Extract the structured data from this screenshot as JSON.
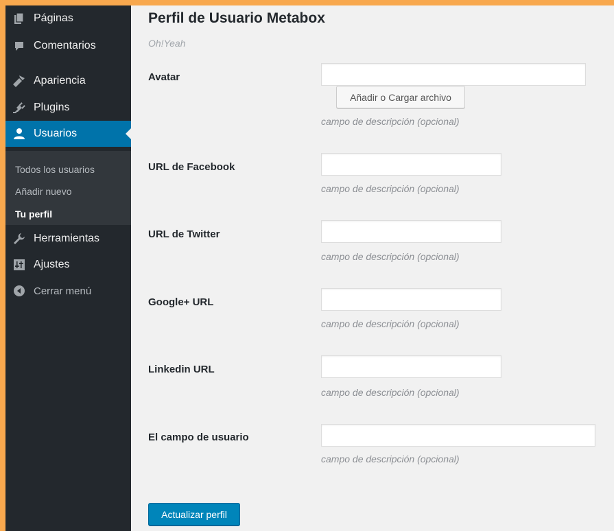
{
  "sidebar": {
    "items": [
      {
        "label": "Páginas",
        "icon": "pages-icon"
      },
      {
        "label": "Comentarios",
        "icon": "comments-icon"
      },
      {
        "label": "Apariencia",
        "icon": "appearance-icon"
      },
      {
        "label": "Plugins",
        "icon": "plugins-icon"
      },
      {
        "label": "Usuarios",
        "icon": "users-icon",
        "active": true
      },
      {
        "label": "Herramientas",
        "icon": "tools-icon"
      },
      {
        "label": "Ajustes",
        "icon": "settings-icon"
      },
      {
        "label": "Cerrar menú",
        "icon": "collapse-menu-icon"
      }
    ],
    "submenu": [
      {
        "label": "Todos los usuarios"
      },
      {
        "label": "Añadir nuevo"
      },
      {
        "label": "Tu perfil",
        "current": true
      }
    ]
  },
  "main": {
    "title": "Perfil de Usuario Metabox",
    "subtitle": "Oh!Yeah",
    "upload_button": "Añadir o Cargar archivo",
    "fields": [
      {
        "label": "Avatar",
        "value": "",
        "description": "campo de descripción (opcional)"
      },
      {
        "label": "URL de Facebook",
        "value": "",
        "description": "campo de descripción (opcional)"
      },
      {
        "label": "URL de Twitter",
        "value": "",
        "description": "campo de descripción (opcional)"
      },
      {
        "label": "Google+ URL",
        "value": "",
        "description": "campo de descripción (opcional)"
      },
      {
        "label": "Linkedin URL",
        "value": "",
        "description": "campo de descripción (opcional)"
      },
      {
        "label": "El campo de usuario",
        "value": "",
        "description": "campo de descripción (opcional)"
      }
    ],
    "submit_button": "Actualizar perfil"
  },
  "colors": {
    "sidebar_bg": "#23282d",
    "submenu_bg": "#32373c",
    "accent": "#0073aa",
    "primary_button": "#0085ba",
    "frame": "#f8a84e"
  }
}
